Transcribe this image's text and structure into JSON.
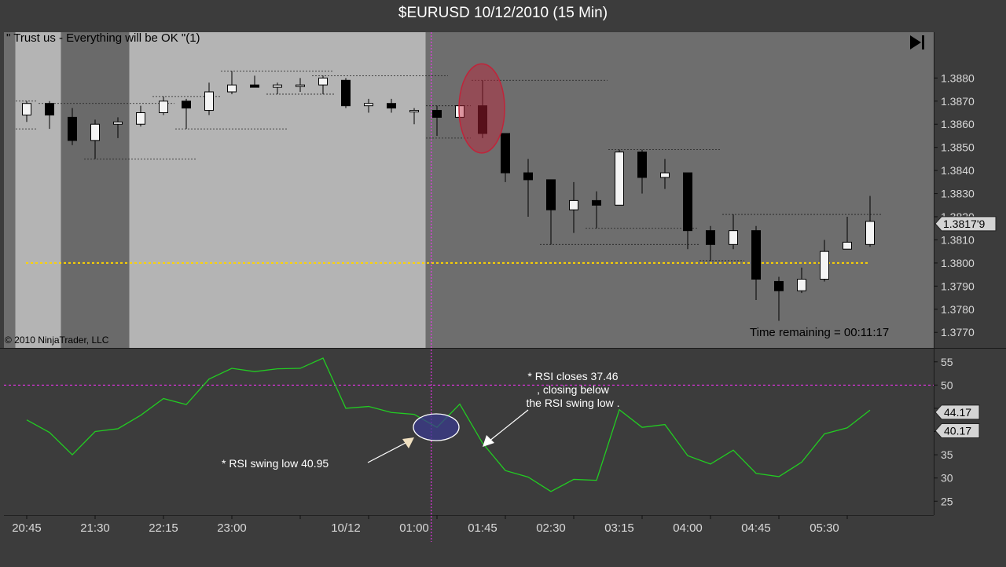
{
  "window_title": "$EURUSD  10/12/2010 (15 Min)",
  "colors": {
    "background": "#3c3c3c",
    "session_light": "#b4b4b4",
    "session_dark": "#6a6a6a",
    "panel_dark": "#6e6e6e",
    "rsi_line": "#22cc22",
    "level_line": "#ff33ff",
    "dotted_line": "#ffd400",
    "highlight_ellipse": "#c0243a"
  },
  "icons": {
    "scroll_end": "scroll-to-end-icon"
  },
  "chart_data": [
    {
      "type": "candlestick",
      "title": "\" Trust us - Everything will be OK \"(1)",
      "copyright": "© 2010 NinjaTrader, LLC",
      "time_remaining": "Time remaining = 00:11:17",
      "ylim": [
        1.3766,
        1.3892
      ],
      "y_ticks": [
        "1.3880",
        "1.3870",
        "1.3860",
        "1.3850",
        "1.3840",
        "1.3830",
        "1.3820",
        "1.3810",
        "1.3800",
        "1.3790",
        "1.3780",
        "1.3770"
      ],
      "price_marker": "1.3817'9",
      "last_price": 1.3817,
      "horizontal_level": 1.38,
      "candles": [
        {
          "time": "20:45",
          "o": 1.3864,
          "h": 1.387,
          "l": 1.3861,
          "c": 1.3869
        },
        {
          "time": "21:00",
          "o": 1.3869,
          "h": 1.387,
          "l": 1.3858,
          "c": 1.3864
        },
        {
          "time": "21:15",
          "o": 1.3863,
          "h": 1.3867,
          "l": 1.3851,
          "c": 1.3853
        },
        {
          "time": "21:30",
          "o": 1.3853,
          "h": 1.3862,
          "l": 1.3845,
          "c": 1.386
        },
        {
          "time": "21:45",
          "o": 1.386,
          "h": 1.3863,
          "l": 1.3854,
          "c": 1.3861
        },
        {
          "time": "22:00",
          "o": 1.386,
          "h": 1.3868,
          "l": 1.3859,
          "c": 1.3865
        },
        {
          "time": "22:15",
          "o": 1.3865,
          "h": 1.3872,
          "l": 1.3864,
          "c": 1.387
        },
        {
          "time": "22:30",
          "o": 1.387,
          "h": 1.3871,
          "l": 1.3858,
          "c": 1.3867
        },
        {
          "time": "22:45",
          "o": 1.3866,
          "h": 1.3878,
          "l": 1.3864,
          "c": 1.3874
        },
        {
          "time": "23:00",
          "o": 1.3874,
          "h": 1.3883,
          "l": 1.3873,
          "c": 1.3877
        },
        {
          "time": "23:15",
          "o": 1.3877,
          "h": 1.3881,
          "l": 1.3876,
          "c": 1.3876
        },
        {
          "time": "23:30",
          "o": 1.3876,
          "h": 1.3878,
          "l": 1.3873,
          "c": 1.3877
        },
        {
          "time": "23:45",
          "o": 1.3877,
          "h": 1.388,
          "l": 1.3874,
          "c": 1.3877
        },
        {
          "time": "00:00",
          "o": 1.3877,
          "h": 1.3881,
          "l": 1.3873,
          "c": 1.388
        },
        {
          "time": "10/12",
          "o": 1.3879,
          "h": 1.388,
          "l": 1.3867,
          "c": 1.3868
        },
        {
          "time": "00:30",
          "o": 1.3868,
          "h": 1.3871,
          "l": 1.3865,
          "c": 1.3869
        },
        {
          "time": "00:45",
          "o": 1.3869,
          "h": 1.3871,
          "l": 1.3865,
          "c": 1.3867
        },
        {
          "time": "01:00",
          "o": 1.3866,
          "h": 1.3867,
          "l": 1.386,
          "c": 1.3866
        },
        {
          "time": "01:15",
          "o": 1.3866,
          "h": 1.3868,
          "l": 1.3855,
          "c": 1.3863
        },
        {
          "time": "01:30",
          "o": 1.3863,
          "h": 1.3868,
          "l": 1.3863,
          "c": 1.3868
        },
        {
          "time": "01:45",
          "o": 1.3868,
          "h": 1.3879,
          "l": 1.3854,
          "c": 1.3856
        },
        {
          "time": "02:00",
          "o": 1.3856,
          "h": 1.3856,
          "l": 1.3835,
          "c": 1.3839
        },
        {
          "time": "02:15",
          "o": 1.3839,
          "h": 1.3845,
          "l": 1.382,
          "c": 1.3836
        },
        {
          "time": "02:30",
          "o": 1.3836,
          "h": 1.3836,
          "l": 1.3808,
          "c": 1.3823
        },
        {
          "time": "02:45",
          "o": 1.3823,
          "h": 1.3835,
          "l": 1.3813,
          "c": 1.3827
        },
        {
          "time": "03:00",
          "o": 1.3827,
          "h": 1.3831,
          "l": 1.3815,
          "c": 1.3825
        },
        {
          "time": "03:15",
          "o": 1.3825,
          "h": 1.3849,
          "l": 1.3825,
          "c": 1.3848
        },
        {
          "time": "03:30",
          "o": 1.3848,
          "h": 1.3849,
          "l": 1.383,
          "c": 1.3837
        },
        {
          "time": "03:45",
          "o": 1.3837,
          "h": 1.3845,
          "l": 1.3832,
          "c": 1.3839
        },
        {
          "time": "04:00",
          "o": 1.3839,
          "h": 1.3839,
          "l": 1.3806,
          "c": 1.3814
        },
        {
          "time": "04:15",
          "o": 1.3814,
          "h": 1.3816,
          "l": 1.3801,
          "c": 1.3808
        },
        {
          "time": "04:30",
          "o": 1.3808,
          "h": 1.3821,
          "l": 1.3806,
          "c": 1.3814
        },
        {
          "time": "04:45",
          "o": 1.3814,
          "h": 1.3816,
          "l": 1.3784,
          "c": 1.3793
        },
        {
          "time": "05:00",
          "o": 1.3792,
          "h": 1.3794,
          "l": 1.3775,
          "c": 1.3788
        },
        {
          "time": "05:15",
          "o": 1.3788,
          "h": 1.3798,
          "l": 1.3787,
          "c": 1.3793
        },
        {
          "time": "05:30",
          "o": 1.3793,
          "h": 1.381,
          "l": 1.3792,
          "c": 1.3805
        },
        {
          "time": "05:45",
          "o": 1.3806,
          "h": 1.382,
          "l": 1.3806,
          "c": 1.3809
        },
        {
          "time": "06:00",
          "o": 1.3808,
          "h": 1.3829,
          "l": 1.3807,
          "c": 1.3818
        }
      ],
      "swing_levels": [
        {
          "y": 1.387,
          "from": 0,
          "to": 0,
          "type": "high"
        },
        {
          "y": 1.3858,
          "from": 0,
          "to": 0,
          "type": "low"
        },
        {
          "y": 1.3869,
          "from": 1,
          "to": 6,
          "type": "high"
        },
        {
          "y": 1.3845,
          "from": 3,
          "to": 7,
          "type": "low"
        },
        {
          "y": 1.3872,
          "from": 6,
          "to": 8,
          "type": "high"
        },
        {
          "y": 1.3858,
          "from": 7,
          "to": 11,
          "type": "low"
        },
        {
          "y": 1.3883,
          "from": 9,
          "to": 13,
          "type": "high"
        },
        {
          "y": 1.3873,
          "from": 11,
          "to": 13,
          "type": "low"
        },
        {
          "y": 1.3881,
          "from": 13,
          "to": 18,
          "type": "high"
        },
        {
          "y": 1.3868,
          "from": 18,
          "to": 19,
          "type": "high"
        },
        {
          "y": 1.3854,
          "from": 18,
          "to": 19,
          "type": "low"
        },
        {
          "y": 1.3879,
          "from": 20,
          "to": 25,
          "type": "high"
        },
        {
          "y": 1.3808,
          "from": 23,
          "to": 29,
          "type": "low"
        },
        {
          "y": 1.3849,
          "from": 26,
          "to": 30,
          "type": "high"
        },
        {
          "y": 1.3815,
          "from": 25,
          "to": 29,
          "type": "low"
        },
        {
          "y": 1.3821,
          "from": 31,
          "to": 37,
          "type": "high"
        },
        {
          "y": 1.3801,
          "from": 30,
          "to": 31,
          "type": "low"
        }
      ],
      "sessions": [
        {
          "from": -0.5,
          "to": 1.5,
          "shade": "light"
        },
        {
          "from": 1.5,
          "to": 4.5,
          "shade": "dark"
        },
        {
          "from": 4.5,
          "to": 17.5,
          "shade": "light"
        },
        {
          "from": 17.5,
          "to": 41,
          "shade": "panel"
        }
      ]
    },
    {
      "type": "line",
      "name": "RSI",
      "ylim": [
        22,
        58
      ],
      "y_ticks": [
        "55",
        "50",
        "45",
        "40",
        "35",
        "30",
        "25"
      ],
      "reference_level": 50,
      "value_markers": [
        "44.17",
        "40.17"
      ],
      "values": [
        42.5,
        39.8,
        35.0,
        40.0,
        40.6,
        43.5,
        47.1,
        45.8,
        51.3,
        53.6,
        52.9,
        53.5,
        53.6,
        55.8,
        45.0,
        45.4,
        44.1,
        43.7,
        40.9,
        45.9,
        37.5,
        31.6,
        30.2,
        27.1,
        29.7,
        29.5,
        44.7,
        40.9,
        41.5,
        34.8,
        33.0,
        36.0,
        31.0,
        30.3,
        33.4,
        39.5,
        40.8,
        44.6
      ]
    }
  ],
  "x_axis": {
    "labels": [
      {
        "idx": 0,
        "text": "20:45"
      },
      {
        "idx": 3,
        "text": "21:30"
      },
      {
        "idx": 6,
        "text": "22:15"
      },
      {
        "idx": 9,
        "text": "23:00"
      },
      {
        "idx": 14,
        "text": "10/12"
      },
      {
        "idx": 17,
        "text": "01:00"
      },
      {
        "idx": 20,
        "text": "01:45"
      },
      {
        "idx": 23,
        "text": "02:30"
      },
      {
        "idx": 26,
        "text": "03:15"
      },
      {
        "idx": 29,
        "text": "04:00"
      },
      {
        "idx": 32,
        "text": "04:45"
      },
      {
        "idx": 35,
        "text": "05:30"
      }
    ]
  },
  "annotations": {
    "rsi_closes_line1": "* RSI closes 37.46",
    "rsi_closes_line2": ", closing below",
    "rsi_closes_line3": "the RSI swing low .",
    "rsi_swing_low": "* RSI swing low 40.95"
  }
}
